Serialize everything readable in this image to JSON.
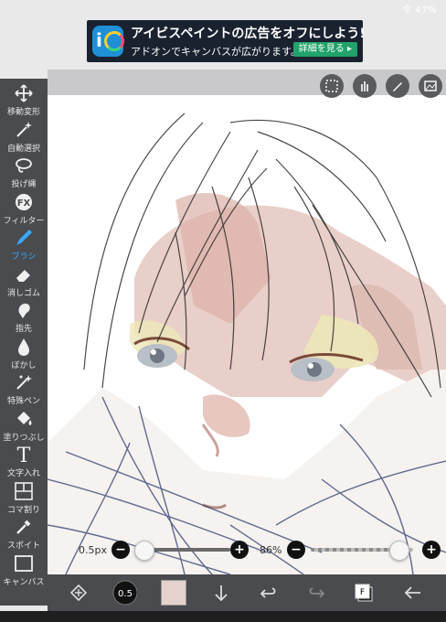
{
  "status": {
    "right": "令 47%"
  },
  "ad": {
    "logo_letter": "i",
    "title": "アイビスペイントの広告をオフにしよう!",
    "subtitle": "アドオンでキャンバスが広がります。",
    "cta": "詳細を見る ▸"
  },
  "tools": [
    {
      "label": "移動変形",
      "icon": "move-icon"
    },
    {
      "label": "自動選択",
      "icon": "magic-wand-icon"
    },
    {
      "label": "投げ縄",
      "icon": "lasso-icon"
    },
    {
      "label": "フィルター",
      "icon": "filter-fx-icon"
    },
    {
      "label": "ブラシ",
      "icon": "brush-icon",
      "active": true
    },
    {
      "label": "消しゴム",
      "icon": "eraser-icon"
    },
    {
      "label": "指先",
      "icon": "finger-icon"
    },
    {
      "label": "ぼかし",
      "icon": "blur-drop-icon"
    },
    {
      "label": "特殊ペン",
      "icon": "special-pen-icon"
    },
    {
      "label": "塗りつぶし",
      "icon": "fill-bucket-icon"
    },
    {
      "label": "文字入れ",
      "icon": "text-icon"
    },
    {
      "label": "コマ割り",
      "icon": "frame-divider-icon"
    },
    {
      "label": "スポイト",
      "icon": "eyedropper-icon"
    },
    {
      "label": "キャンバス",
      "icon": "canvas-icon"
    }
  ],
  "fx_text": "FX",
  "text_tool_glyph": "T",
  "brush_size": {
    "label": "0.5px",
    "value": 0.5,
    "minus": "−",
    "plus": "+"
  },
  "opacity": {
    "label": "86%",
    "value": 0.86,
    "minus": "−",
    "plus": "+"
  },
  "bottom": {
    "brush_indicator": "0.5",
    "layer_label": "F"
  },
  "colors": {
    "toolbar": "#4a4b4e",
    "accent": "#39a8ff",
    "current_color": "#e5d2cc"
  }
}
